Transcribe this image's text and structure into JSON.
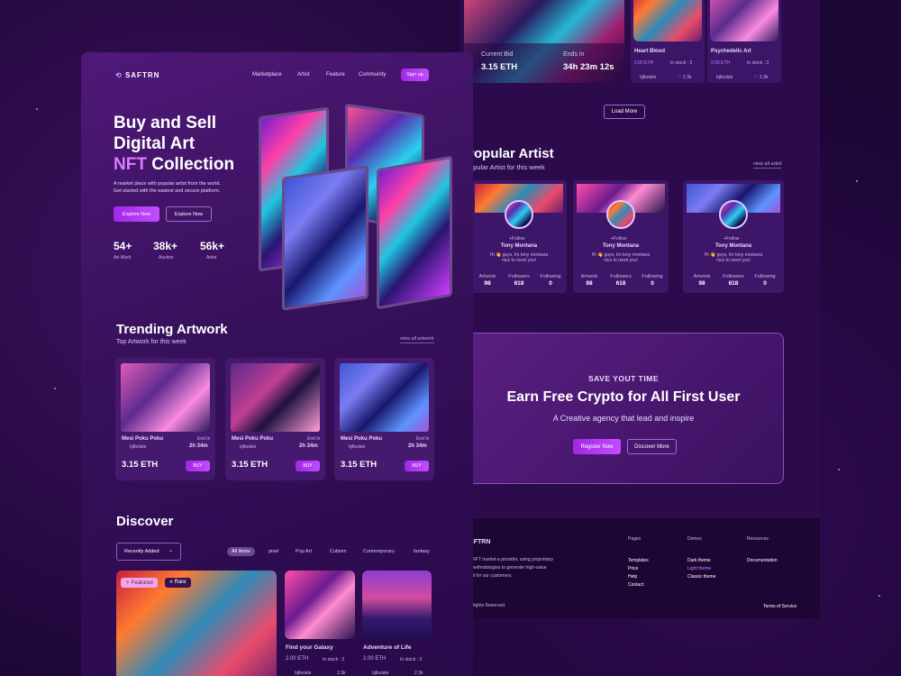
{
  "brand": "SAFTRN",
  "nav": [
    "Marketplace",
    "Artist",
    "Feature",
    "Community"
  ],
  "signup": "Sign up",
  "hero": {
    "line1": "Buy and Sell",
    "line2": "Digital Art",
    "line3_accent": "NFT",
    "line3_rest": " Collection",
    "desc1": "A market place with popular artist from the world.",
    "desc2": "Get started with the easiest and secure platform.",
    "cta_primary": "Explore Now",
    "cta_secondary": "Explore Now",
    "stats": [
      {
        "value": "54+",
        "label": "Art Work"
      },
      {
        "value": "38k+",
        "label": "Auction"
      },
      {
        "value": "56k+",
        "label": "Artist"
      }
    ]
  },
  "trending": {
    "title": "Trending Artwork",
    "subtitle": "Top Artwork for this week",
    "view_all": "view all artwork",
    "cards": [
      {
        "title": "Mesi Poku Poku",
        "ends_label": "End In",
        "ends": "2h 34m",
        "owner": "bjlbolale",
        "price": "3.15 ETH",
        "buy": "BUY"
      },
      {
        "title": "Mesi Poku Poku",
        "ends_label": "End In",
        "ends": "2h 34m",
        "owner": "bjlbolale",
        "price": "3.15 ETH",
        "buy": "BUY"
      },
      {
        "title": "Mesi Poku Poku",
        "ends_label": "End In",
        "ends": "2h 34m",
        "owner": "bjlbolale",
        "price": "3.15 ETH",
        "buy": "BUY"
      }
    ]
  },
  "discover": {
    "title": "Discover",
    "sort": "Recently Added",
    "filters": [
      "All items",
      "pixel",
      "Pop Art",
      "Cubism",
      "Contemporary",
      "fantasy"
    ],
    "badges": [
      "Featured",
      "Rare"
    ],
    "items": [
      {
        "title": "Find your Galaxy",
        "price": "2.00 ETH",
        "stock": "In stock : 3",
        "owner": "bjlbolale",
        "likes": "2.3k"
      },
      {
        "title": "Adventure of Life",
        "price": "2.00 ETH",
        "stock": "In stock : 3",
        "owner": "bjlbolale",
        "likes": "2.3k"
      }
    ]
  },
  "auction": {
    "current_bid_label": "Current Bid",
    "current_bid": "3.15 ETH",
    "ends_label": "Ends in",
    "ends": "34h 23m 12s"
  },
  "top_items": [
    {
      "title": "Heart Blood",
      "price": "2.00 ETH",
      "stock": "In stock : 3",
      "owner": "bjlbolale",
      "likes": "2.3k"
    },
    {
      "title": "Psychedelic Art",
      "price": "2.00 ETH",
      "stock": "In stock : 3",
      "owner": "bjlbolale",
      "likes": "2.3k"
    }
  ],
  "load_more": "Load More",
  "popular": {
    "title": "Popular Artist",
    "subtitle": "Popular Artist for this week",
    "view_all": "view all artist",
    "artists": [
      {
        "follow": "+Follow",
        "name": "Tony Montana",
        "bio1": "Hi 👋 guys, Im tony montana",
        "bio2": "nice to meet you!",
        "labels": [
          "Artwork",
          "Followers",
          "Following"
        ],
        "values": [
          "98",
          "618",
          "0"
        ]
      },
      {
        "follow": "+Follow",
        "name": "Tony Montana",
        "bio1": "Hi 👋 guys, Im tony montana",
        "bio2": "nice to meet you!",
        "labels": [
          "Artwork",
          "Followers",
          "Following"
        ],
        "values": [
          "98",
          "618",
          "0"
        ]
      },
      {
        "follow": "+Follow",
        "name": "Tony Montana",
        "bio1": "Hi 👋 guys, Im tony montana",
        "bio2": "nice to meet you!",
        "labels": [
          "Artwork",
          "Followers",
          "Following"
        ],
        "values": [
          "98",
          "618",
          "0"
        ]
      }
    ]
  },
  "promo": {
    "eyebrow": "SAVE YOUT TIME",
    "title": "Earn Free Crypto for All First User",
    "subtitle": "A Creative agency that lead and inspire",
    "primary": "Register Now",
    "secondary": "Discover More"
  },
  "footer": {
    "brand": "SAFTRN",
    "desc1": "ing NFT market-a provider, using proprietary",
    "desc2": "nd methodologies to generate high-value",
    "desc3": "ment for our customers.",
    "copyright": "All Rights Reserved.",
    "columns": [
      {
        "title": "Pages",
        "links": [
          "Templates",
          "Price",
          "Help",
          "Contact"
        ]
      },
      {
        "title": "Demos",
        "links": [
          "Dark theme",
          "Light theme",
          "Classic theme"
        ]
      },
      {
        "title": "Resources",
        "links": [
          "Documentation"
        ]
      }
    ],
    "terms": "Terms of Service"
  },
  "colors": {
    "accent": "#b63cf2",
    "bg": "#1c0636",
    "panel": "#3a1160"
  }
}
